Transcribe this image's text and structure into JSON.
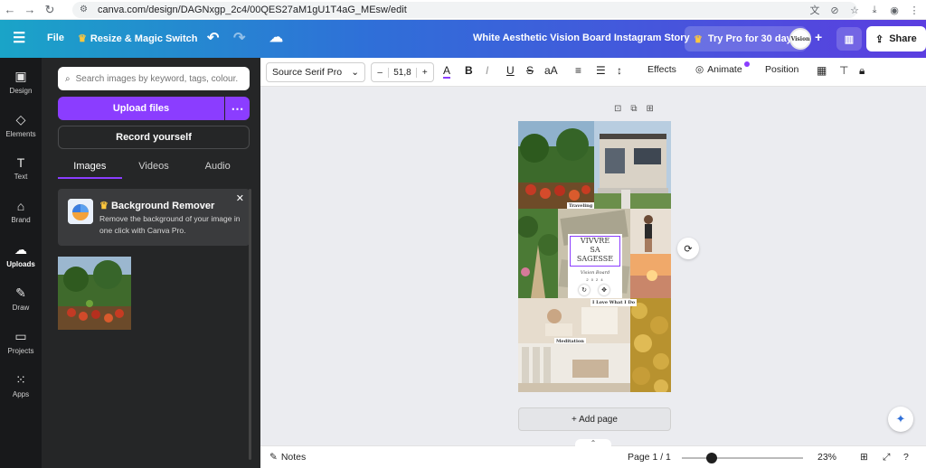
{
  "browser": {
    "url": "canva.com/design/DAGNxgp_2c4/00QES27aM1gU1T4aG_MEsw/edit"
  },
  "topbar": {
    "menu_icon": "hamburger-icon",
    "file_label": "File",
    "resize_label": "Resize & Magic Switch",
    "doc_title": "White Aesthetic Vision Board Instagram Story",
    "try_pro_label": "Try Pro for 30 days",
    "share_label": "Share",
    "avatar_text": "Vision"
  },
  "rail": {
    "items": [
      {
        "label": "Design",
        "icon": "layout-icon"
      },
      {
        "label": "Elements",
        "icon": "shapes-icon"
      },
      {
        "label": "Text",
        "icon": "text-icon"
      },
      {
        "label": "Brand",
        "icon": "brand-icon"
      },
      {
        "label": "Uploads",
        "icon": "cloud-upload-icon"
      },
      {
        "label": "Draw",
        "icon": "pen-icon"
      },
      {
        "label": "Projects",
        "icon": "folder-icon"
      },
      {
        "label": "Apps",
        "icon": "grid-icon"
      }
    ]
  },
  "panel": {
    "search_placeholder": "Search images by keyword, tags, colour...",
    "upload_label": "Upload files",
    "record_label": "Record yourself",
    "tabs": [
      "Images",
      "Videos",
      "Audio"
    ],
    "promo_title": "Background Remover",
    "promo_desc": "Remove the background of your image in one click with Canva Pro."
  },
  "toolbar": {
    "font_name": "Source Serif Pro",
    "font_size": "51,8",
    "effects_label": "Effects",
    "animate_label": "Animate",
    "position_label": "Position"
  },
  "board": {
    "labels": {
      "traveling": "Traveling",
      "love": "I Love What I Do",
      "meditation": "Meditation",
      "title_line1": "VIVVRE",
      "title_line2": "SA",
      "title_line3": "SAGESSE",
      "vision": "Vision Board",
      "year": "2 0 2 4"
    }
  },
  "canvas": {
    "add_page_label": "+ Add page"
  },
  "footer": {
    "notes_label": "Notes",
    "page_label": "Page 1 / 1",
    "zoom_label": "23%"
  },
  "colors": {
    "accent": "#8b3dff",
    "rail_bg": "#18191b",
    "panel_bg": "#252627",
    "canvas_bg": "#ebecf0"
  }
}
